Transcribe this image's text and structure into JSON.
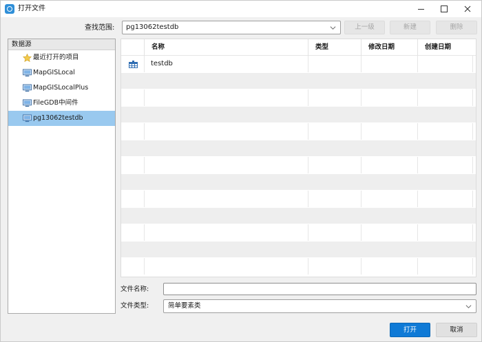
{
  "window": {
    "title": "打开文件"
  },
  "lookin": {
    "label": "查找范围:",
    "value": "pg13062testdb"
  },
  "toolbar": {
    "up_label": "上一级",
    "new_label": "新建",
    "delete_label": "删除"
  },
  "sources": {
    "header": "数据源",
    "items": [
      {
        "label": "最近打开的项目",
        "icon": "star-icon"
      },
      {
        "label": "MapGISLocal",
        "icon": "monitor-icon"
      },
      {
        "label": "MapGISLocalPlus",
        "icon": "monitor-icon"
      },
      {
        "label": "FileGDB中间件",
        "icon": "monitor-icon"
      },
      {
        "label": "pg13062testdb",
        "icon": "monitor-icon",
        "selected": true
      }
    ]
  },
  "file_list": {
    "columns": [
      "名称",
      "类型",
      "修改日期",
      "创建日期"
    ],
    "rows": [
      {
        "name": "testdb",
        "type": "",
        "modified": "",
        "created": "",
        "icon": "database-icon"
      }
    ]
  },
  "fields": {
    "filename_label": "文件名称:",
    "filename_value": "",
    "filetype_label": "文件类型:",
    "filetype_value": "简单要素类"
  },
  "buttons": {
    "open_label": "打开",
    "cancel_label": "取消"
  },
  "colors": {
    "accent": "#0f7ad6",
    "selection": "#99c9ef"
  }
}
